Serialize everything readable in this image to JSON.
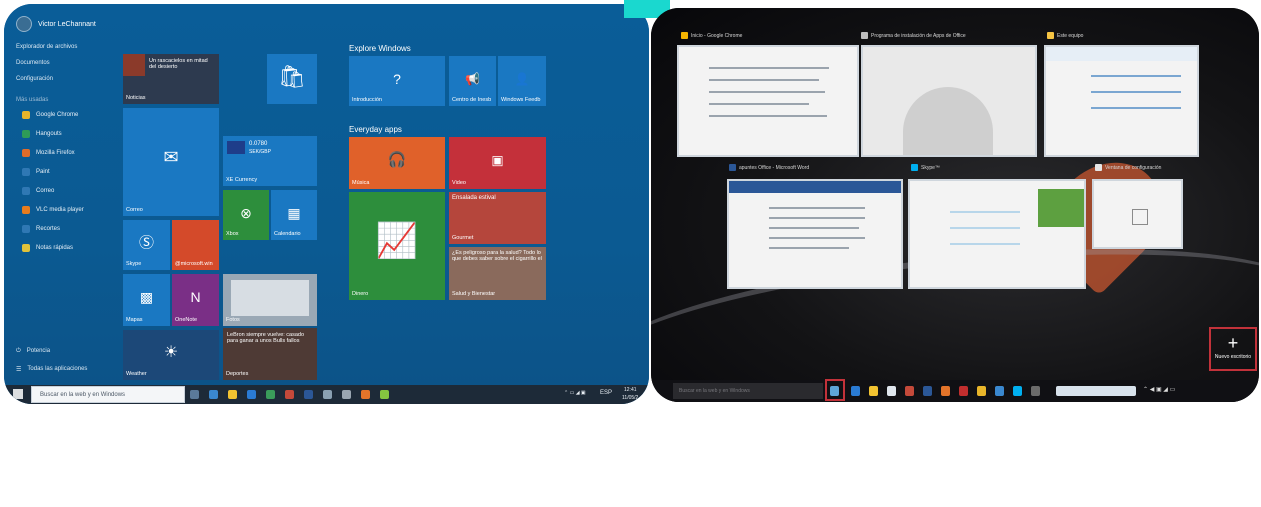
{
  "left_screen": {
    "user_name": "Victor LeChannant",
    "nav_links": [
      "Explorador de archivos",
      "Documentos",
      "Configuración"
    ],
    "most_used_label": "Más usadas",
    "apps": [
      "Google Chrome",
      "Hangouts",
      "Mozilla Firefox",
      "Paint",
      "Correo",
      "VLC media player",
      "Recortes",
      "Notas rápidas"
    ],
    "power_label": "Potencia",
    "all_apps_label": "Todas las aplicaciones",
    "tiles": {
      "noticias_headline": "Un rascacielos en mitad del desierto",
      "noticias_label": "Noticias",
      "correo_label": "Correo",
      "currency_value": "0.0780",
      "currency_pair": "SEK/GBP",
      "currency_label": "XE Currency",
      "xbox_label": "Xbox",
      "calendario_label": "Calendario",
      "skype_label": "Skype",
      "microsoft_label": "@microsoft.win",
      "mapas_label": "Mapas",
      "onenote_label": "OneNote",
      "fotos_label": "Fotos",
      "deportes_headline": "LeBron siempre vuelve: casado para ganar a unos Bulls fallos",
      "deportes_label": "Deportes",
      "weather_label": "Weather",
      "explore_header": "Explore Windows",
      "introduccion_label": "Introducción",
      "centro_label": "Centro de Inesb",
      "feedback_label": "Windows Feedb",
      "everyday_header": "Everyday apps",
      "musica_label": "Música",
      "video_label": "Video",
      "gourmet_headline": "Ensalada estival",
      "gourmet_label": "Gourmet",
      "dinero_label": "Dinero",
      "salud_headline": "¿Es peligroso para la salud? Todo lo que debes saber sobre el cigarrillo el",
      "salud_label": "Salud y Bienestar"
    },
    "taskbar": {
      "search_placeholder": "Buscar en la web y en Windows",
      "lang": "ESP",
      "time": "12:41",
      "date": "11/05/2"
    },
    "colors": {
      "bg": "#0b5a93",
      "tile_blue": "#1a78c2",
      "tile_orange": "#e0612a",
      "tile_red": "#c4303a",
      "tile_green": "#2d8e3c",
      "tile_dark": "#1a3f6b"
    }
  },
  "right_screen": {
    "windows_top": [
      {
        "title": "Inicio - Google Chrome",
        "icon_color": "#f4b400"
      },
      {
        "title": "Programa de instalación de Apps de Office",
        "icon_color": "#bdbdbd"
      },
      {
        "title": "Este equipo",
        "icon_color": "#f6c443"
      }
    ],
    "windows_bottom": [
      {
        "title": "apuntes Office - Microsoft Word",
        "icon_color": "#2b5797"
      },
      {
        "title": "Skype™",
        "icon_color": "#00aff0"
      },
      {
        "title": "Ventana de configuración",
        "icon_color": "#e5e5e5"
      }
    ],
    "new_desktop_label": "Nuevo escritorio",
    "new_desktop_symbol": "+",
    "taskbar_search_placeholder": "Buscar en la web y en Windows"
  }
}
